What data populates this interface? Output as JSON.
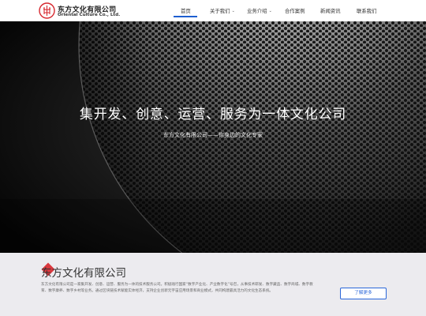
{
  "brand": {
    "name_cn": "东方文化有限公司",
    "name_en": "Oriental Culture Co., Ltd.",
    "accent": "#d7282f"
  },
  "nav": {
    "active_color": "#1e5fd0",
    "items": [
      {
        "label": "首页",
        "active": true
      },
      {
        "label": "关于我们",
        "has_dropdown": true
      },
      {
        "label": "业务介绍",
        "has_dropdown": true
      },
      {
        "label": "合作案例"
      },
      {
        "label": "新闻资讯"
      },
      {
        "label": "联系我们"
      }
    ]
  },
  "hero": {
    "title": "集开发、创意、运营、服务为一体文化公司",
    "subtitle": "东方文化有限公司——你身边的文化专家"
  },
  "about": {
    "title": "东方文化有限公司",
    "text": "东方文化有限公司是一家集开发、创意、运营、服务为一体的技术服务公司。积极践行国家“数字产业化、产业数字化”号召，从事技术研发、数字藏品、数字商城、数字教育、数字康养、数字乡村等业务。通过区块链技术赋能实体经济，支持企业创新元宇宙应用场景和商业模式，共同构建最具活力的文化生态系统。",
    "button_label": "了解更多",
    "button_color": "#2a66d9"
  }
}
